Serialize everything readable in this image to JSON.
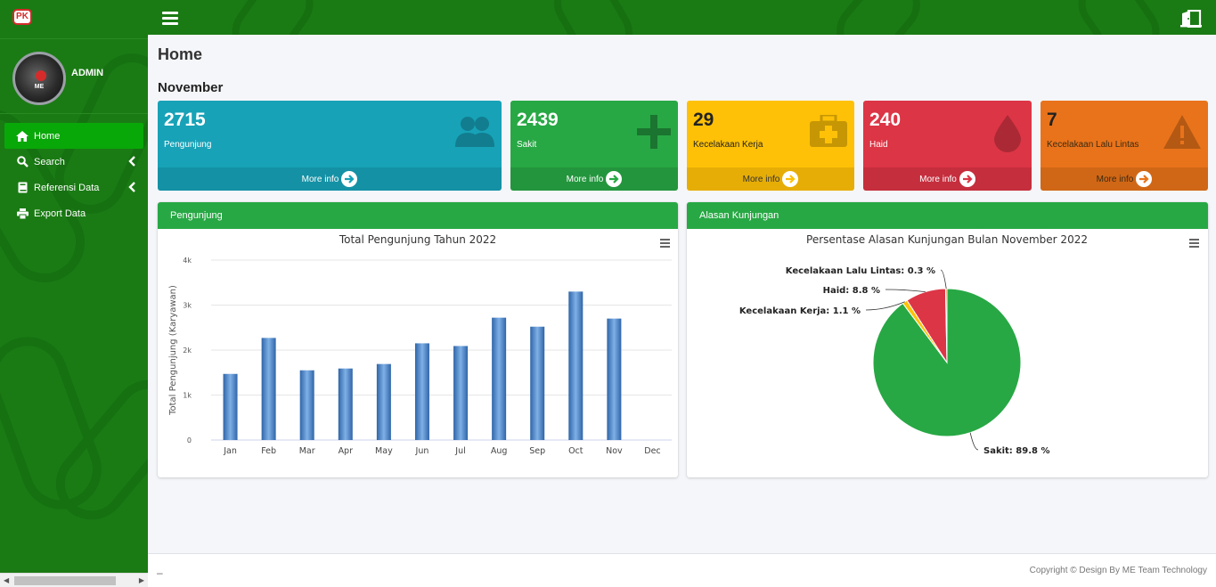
{
  "app": {
    "logo_text": "PK",
    "user_name": "ADMIN",
    "avatar_text": "ME"
  },
  "sidebar": {
    "items": [
      {
        "label": "Home",
        "icon": "home-icon",
        "active": true
      },
      {
        "label": "Search",
        "icon": "search-icon",
        "has_submenu": true
      },
      {
        "label": "Referensi Data",
        "icon": "book-icon",
        "has_submenu": true
      },
      {
        "label": "Export Data",
        "icon": "print-icon"
      }
    ]
  },
  "page": {
    "title": "Home",
    "month": "November"
  },
  "stats": [
    {
      "value": "2715",
      "label": "Pengunjung",
      "footer": "More info",
      "color": "#17a2b8",
      "icon": "users-icon"
    },
    {
      "value": "2439",
      "label": "Sakit",
      "footer": "More info",
      "color": "#28a745",
      "icon": "plus-icon"
    },
    {
      "value": "29",
      "label": "Kecelakaan Kerja",
      "footer": "More info",
      "color": "#ffc107",
      "icon": "medkit-icon"
    },
    {
      "value": "240",
      "label": "Haid",
      "footer": "More info",
      "color": "#dc3545",
      "icon": "drop-icon"
    },
    {
      "value": "7",
      "label": "Kecelakaan Lalu Lintas",
      "footer": "More info",
      "color": "#e8731a",
      "icon": "warning-icon"
    }
  ],
  "cards": {
    "visitors_title": "Pengunjung",
    "reasons_title": "Alasan Kunjungan"
  },
  "chart_data": [
    {
      "type": "bar",
      "title": "Total Pengunjung Tahun 2022",
      "xlabel": "",
      "ylabel": "Total Pengunjung (Karyawan)",
      "categories": [
        "Jan",
        "Feb",
        "Mar",
        "Apr",
        "May",
        "Jun",
        "Jul",
        "Aug",
        "Sep",
        "Oct",
        "Nov",
        "Dec"
      ],
      "values": [
        1470,
        2270,
        1550,
        1590,
        1690,
        2150,
        2090,
        2720,
        2520,
        3300,
        2700,
        0
      ],
      "ylim": [
        0,
        4000
      ],
      "yticks": [
        "0",
        "1k",
        "2k",
        "3k",
        "4k"
      ],
      "grid": true,
      "legend": "none",
      "color": "#4a86c8"
    },
    {
      "type": "pie",
      "title": "Persentase Alasan Kunjungan Bulan November 2022",
      "slices": [
        {
          "name": "Sakit",
          "value": 89.8,
          "label": "Sakit: 89.8 %",
          "color": "#28a745"
        },
        {
          "name": "Kecelakaan Kerja",
          "value": 1.1,
          "label": "Kecelakaan Kerja: 1.1 %",
          "color": "#ffc107"
        },
        {
          "name": "Haid",
          "value": 8.8,
          "label": "Haid: 8.8 %",
          "color": "#dc3545"
        },
        {
          "name": "Kecelakaan Lalu Lintas",
          "value": 0.3,
          "label": "Kecelakaan Lalu Lintas: 0.3 %",
          "color": "#e8731a"
        }
      ]
    }
  ],
  "footer": {
    "left": "–",
    "copyright": "Copyright © Design By ME Team Technology"
  }
}
